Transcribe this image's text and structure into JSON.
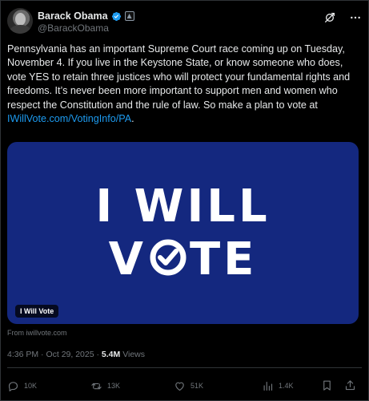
{
  "author": {
    "display_name": "Barack Obama",
    "handle": "@BarackObama"
  },
  "icons": {
    "verified": "verified-badge-icon",
    "affiliation": "government-affiliation-icon",
    "grok": "grok-icon",
    "more": "more-options-icon",
    "reply": "reply-icon",
    "repost": "repost-icon",
    "like": "like-icon",
    "views": "views-icon",
    "bookmark": "bookmark-icon",
    "share": "share-icon"
  },
  "colors": {
    "background": "#000000",
    "text": "#e7e9ea",
    "muted": "#71767b",
    "link": "#1d9bf0",
    "verified": "#1d9bf0",
    "media_background": "#14287f"
  },
  "tweet": {
    "text_before_link": "Pennsylvania has an important Supreme Court race coming up on Tuesday, November 4. If you live in the Keystone State, or know someone who does, vote YES to retain three justices who will protect your fundamental rights and freedoms. It’s never been more important to support men and women who respect the Constitution and the rule of law. So make a plan to vote at ",
    "link_text": "IWillVote.com/VotingInfo/PA",
    "text_after_link": "."
  },
  "media": {
    "headline_line1": "I WILL",
    "headline_line2_prefix": "V",
    "headline_line2_suffix": "TE",
    "card_label": "I Will Vote",
    "source": "From iwillvote.com"
  },
  "meta": {
    "time": "4:36 PM",
    "separator": " · ",
    "date": "Oct 29, 2025",
    "views_count": "5.4M",
    "views_label": "Views"
  },
  "actions": {
    "replies": "10K",
    "reposts": "13K",
    "likes": "51K",
    "views": "1.4K"
  }
}
